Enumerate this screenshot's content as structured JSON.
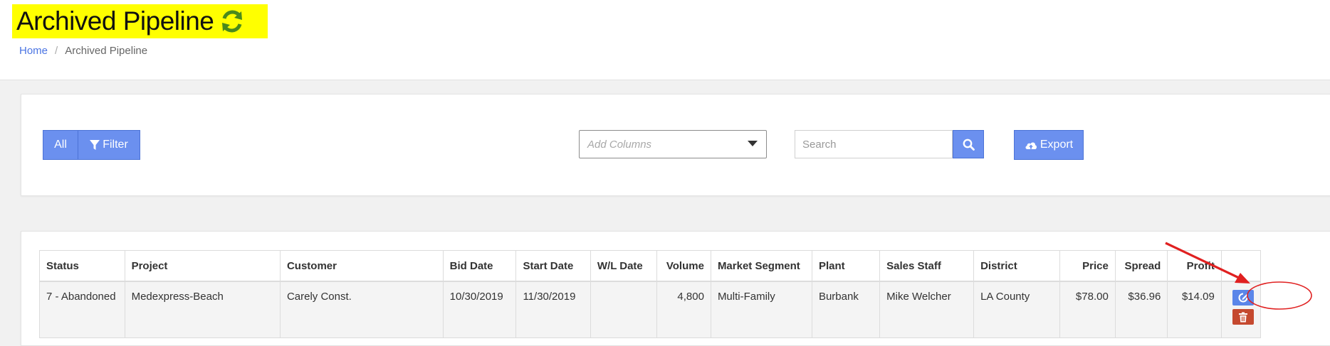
{
  "header": {
    "title": "Archived Pipeline",
    "title_highlight_color": "#ffff00",
    "refresh_icon": "refresh-icon",
    "refresh_icon_color": "#4a8a1c"
  },
  "breadcrumb": {
    "home": "Home",
    "separator": "/",
    "current": "Archived Pipeline"
  },
  "toolbar": {
    "all_label": "All",
    "filter_label": "Filter",
    "filter_icon": "filter-icon",
    "columns_placeholder": "Add Columns",
    "search_placeholder": "Search",
    "search_icon": "search-icon",
    "export_label": "Export",
    "export_icon": "cloud-upload-icon",
    "accent_color": "#6b90ef"
  },
  "table": {
    "columns": [
      "Status",
      "Project",
      "Customer",
      "Bid Date",
      "Start Date",
      "W/L Date",
      "Volume",
      "Market Segment",
      "Plant",
      "Sales Staff",
      "District",
      "Price",
      "Spread",
      "Profit"
    ],
    "rows": [
      {
        "status": "7 - Abandoned",
        "project": "Medexpress-Beach",
        "customer": "Carely Const.",
        "bid_date": "10/30/2019",
        "start_date": "11/30/2019",
        "wl_date": "",
        "volume": "4,800",
        "market_segment": "Multi-Family",
        "plant": "Burbank",
        "sales_staff": "Mike Welcher",
        "district": "LA County",
        "price": "$78.00",
        "spread": "$36.96",
        "profit": "$14.09"
      }
    ],
    "actions": {
      "edit_icon": "edit-icon",
      "edit_color": "#5b86e9",
      "delete_icon": "trash-icon",
      "delete_color": "#c5492f"
    }
  },
  "annotation": {
    "arrow_color": "#e02020",
    "circle_color": "#e02020"
  }
}
